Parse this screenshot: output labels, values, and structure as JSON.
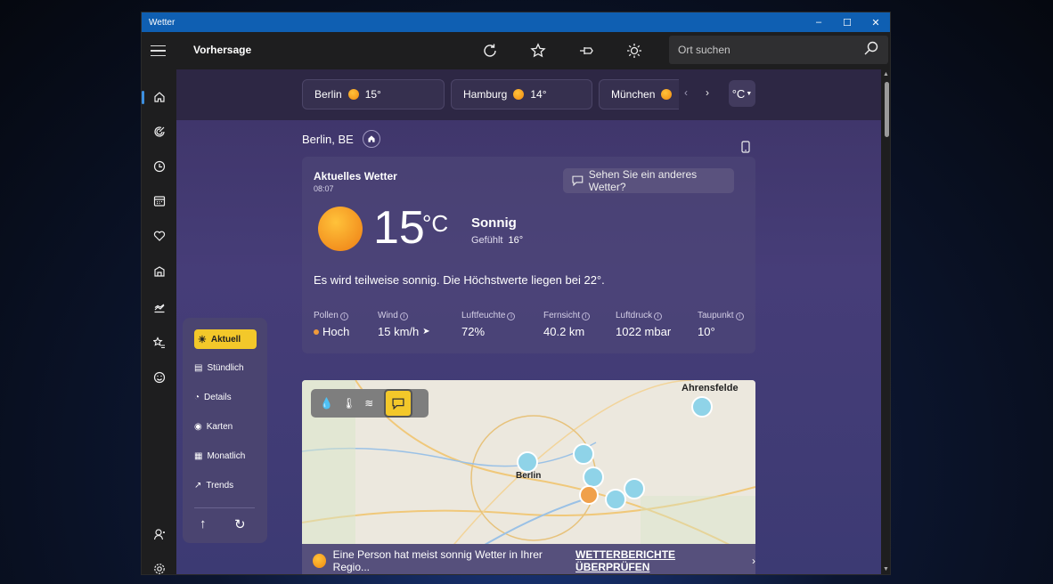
{
  "window": {
    "title": "Wetter",
    "controls": [
      "–",
      "☐",
      "✕"
    ]
  },
  "appbar": {
    "title": "Vorhersage",
    "search_placeholder": "Ort suchen",
    "icons": [
      "refresh-icon",
      "star-icon",
      "pin-icon",
      "brightness-icon",
      "search-icon"
    ]
  },
  "nav": [
    "home",
    "radar",
    "history",
    "calendar",
    "health",
    "buildings",
    "trends",
    "favorites",
    "emoji",
    "account",
    "settings"
  ],
  "cities": [
    {
      "name": "Berlin",
      "temp": "15°"
    },
    {
      "name": "Hamburg",
      "temp": "14°"
    },
    {
      "name": "München",
      "temp": ""
    }
  ],
  "unit_toggle": "°C",
  "location": {
    "name": "Berlin, BE"
  },
  "current": {
    "heading": "Aktuelles Wetter",
    "time": "08:07",
    "feedback": "Sehen Sie ein anderes Wetter?",
    "temp": "15",
    "unit": "°C",
    "condition": "Sonnig",
    "feels_label": "Gefühlt",
    "feels_value": "16°",
    "summary": "Es wird teilweise sonnig. Die Höchstwerte liegen bei 22°.",
    "metrics": [
      {
        "label": "Pollen",
        "value": "Hoch"
      },
      {
        "label": "Wind",
        "value": "15 km/h"
      },
      {
        "label": "Luftfeuchte",
        "value": "72%"
      },
      {
        "label": "Fernsicht",
        "value": "40.2 km"
      },
      {
        "label": "Luftdruck",
        "value": "1022 mbar"
      },
      {
        "label": "Taupunkt",
        "value": "10°"
      }
    ]
  },
  "sidebar": {
    "items": [
      "Aktuell",
      "Stündlich",
      "Details",
      "Karten",
      "Monatlich",
      "Trends"
    ]
  },
  "map": {
    "labels": [
      "Ahrensfelde",
      "Berlin"
    ]
  },
  "banner": {
    "text": "Eine Person hat meist sonnig Wetter in Ihrer Regio...",
    "link": "WETTERBERICHTE ÜBERPRÜFEN"
  }
}
